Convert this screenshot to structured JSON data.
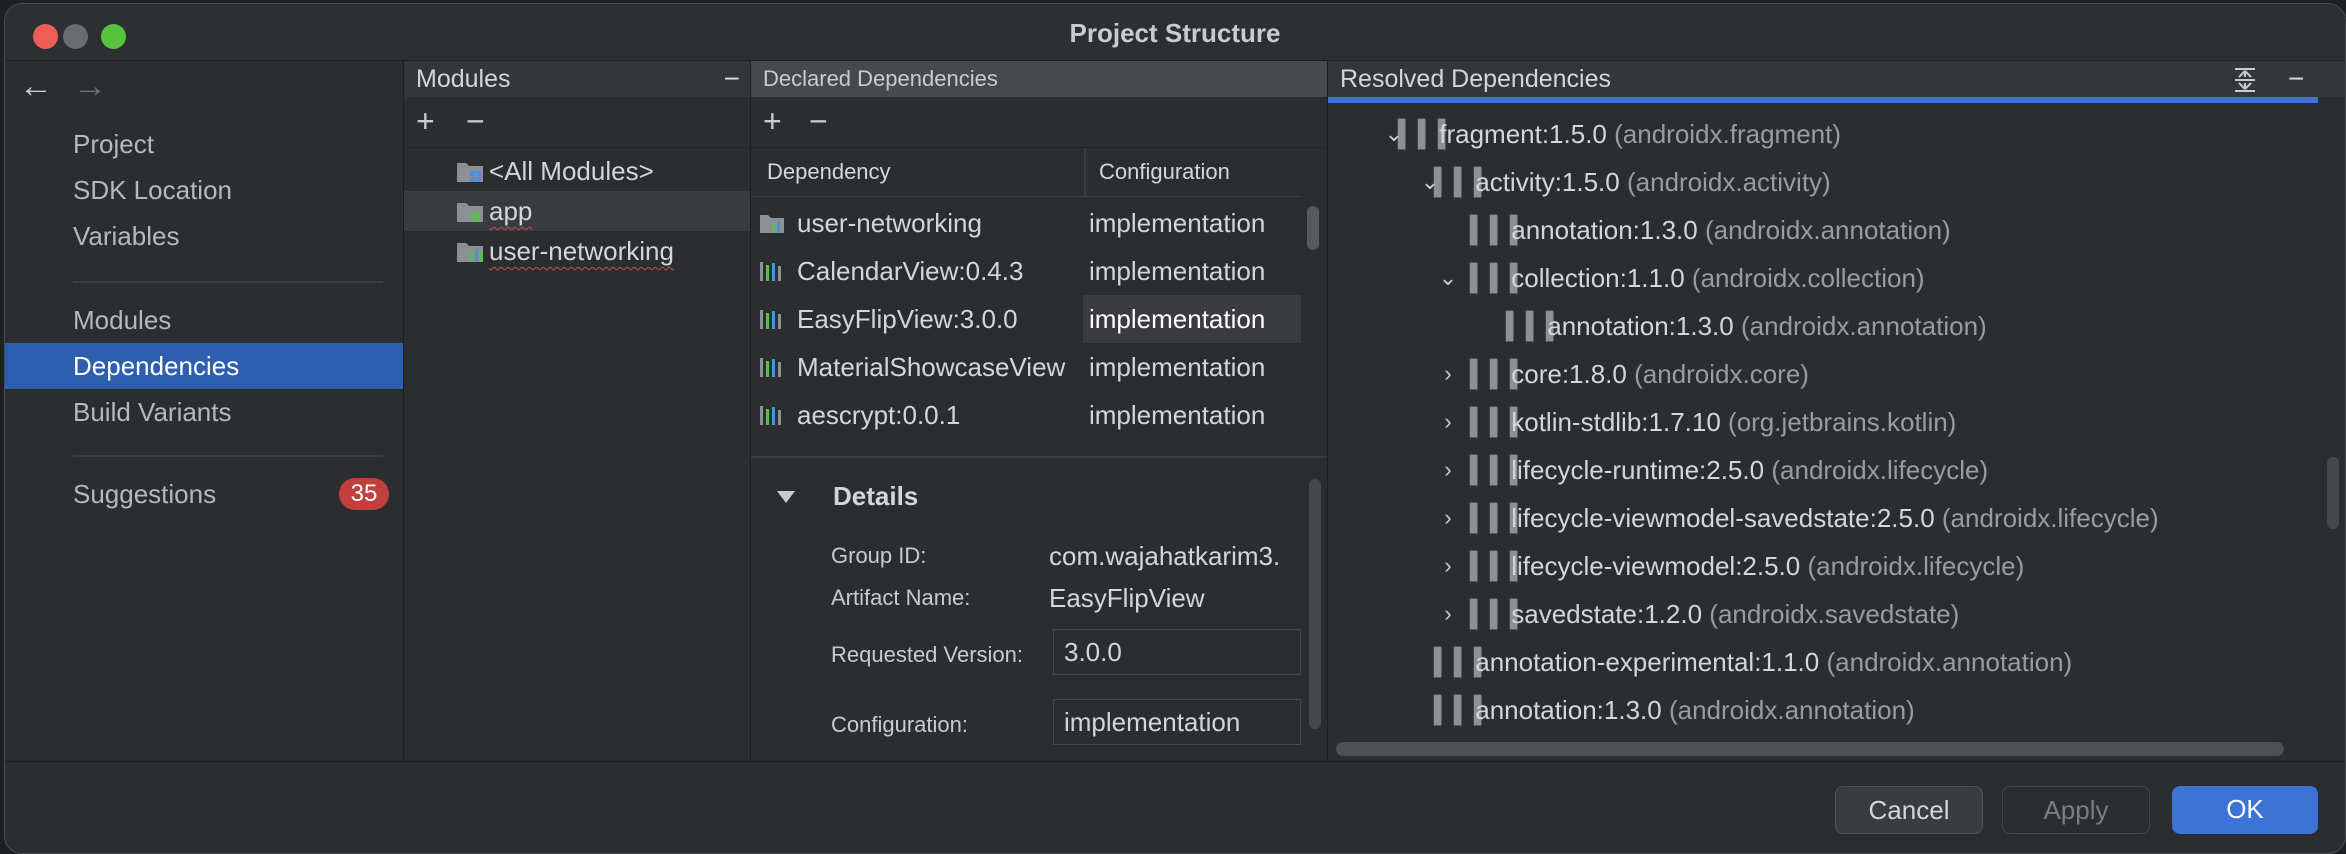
{
  "window": {
    "title": "Project Structure"
  },
  "nav": {
    "back": "←",
    "forward": "→",
    "items": [
      {
        "label": "Project"
      },
      {
        "label": "SDK Location"
      },
      {
        "label": "Variables"
      },
      {
        "label": "Modules"
      },
      {
        "label": "Dependencies"
      },
      {
        "label": "Build Variants"
      },
      {
        "label": "Suggestions",
        "badge": "35"
      }
    ]
  },
  "modules": {
    "title": "Modules",
    "minus": "−",
    "add": "+",
    "remove": "−",
    "items": [
      {
        "label": "<All Modules>"
      },
      {
        "label": "app"
      },
      {
        "label": "user-networking"
      }
    ]
  },
  "declared": {
    "title": "Declared Dependencies",
    "add": "+",
    "remove": "−",
    "columns": [
      "Dependency",
      "Configuration"
    ],
    "rows": [
      {
        "dependency": "user-networking",
        "configuration": "implementation"
      },
      {
        "dependency": "CalendarView:0.4.3",
        "configuration": "implementation"
      },
      {
        "dependency": "EasyFlipView:3.0.0",
        "configuration": "implementation"
      },
      {
        "dependency": "MaterialShowcaseView",
        "configuration": "implementation"
      },
      {
        "dependency": "aescrypt:0.0.1",
        "configuration": "implementation"
      }
    ],
    "details": {
      "title": "Details",
      "group_id_label": "Group ID:",
      "group_id_value": "com.wajahatkarim3.",
      "artifact_label": "Artifact Name:",
      "artifact_value": "EasyFlipView",
      "version_label": "Requested Version:",
      "version_value": "3.0.0",
      "config_label": "Configuration:",
      "config_value": "implementation"
    }
  },
  "resolved": {
    "title": "Resolved Dependencies",
    "rows": [
      {
        "name": "fragment:1.5.0",
        "group": "(androidx.fragment)"
      },
      {
        "name": "activity:1.5.0",
        "group": "(androidx.activity)"
      },
      {
        "name": "annotation:1.3.0",
        "group": "(androidx.annotation)"
      },
      {
        "name": "collection:1.1.0",
        "group": "(androidx.collection)"
      },
      {
        "name": "annotation:1.3.0",
        "group": "(androidx.annotation)"
      },
      {
        "name": "core:1.8.0",
        "group": "(androidx.core)"
      },
      {
        "name": "kotlin-stdlib:1.7.10",
        "group": "(org.jetbrains.kotlin)"
      },
      {
        "name": "lifecycle-runtime:2.5.0",
        "group": "(androidx.lifecycle)"
      },
      {
        "name": "lifecycle-viewmodel-savedstate:2.5.0",
        "group": "(androidx.lifecycle)"
      },
      {
        "name": "lifecycle-viewmodel:2.5.0",
        "group": "(androidx.lifecycle)"
      },
      {
        "name": "savedstate:1.2.0",
        "group": "(androidx.savedstate)"
      },
      {
        "name": "annotation-experimental:1.1.0",
        "group": "(androidx.annotation)"
      },
      {
        "name": "annotation:1.3.0",
        "group": "(androidx.annotation)"
      }
    ]
  },
  "buttons": {
    "cancel": "Cancel",
    "apply": "Apply",
    "ok": "OK"
  },
  "colors": {
    "accent": "#3d73d6",
    "selection": "#2e5fae",
    "badge": "#c1403d"
  }
}
